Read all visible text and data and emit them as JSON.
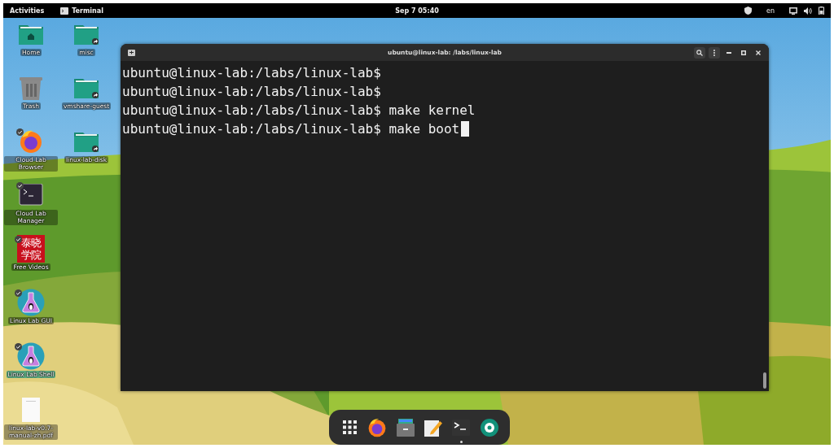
{
  "top_bar": {
    "activities": "Activities",
    "app_name": "Terminal",
    "clock": "Sep 7  05:40",
    "input_source": "en"
  },
  "desktop_columns": [
    [
      {
        "label": "Home",
        "kind": "home-folder",
        "trusted": false,
        "selected": false
      },
      {
        "label": "Trash",
        "kind": "trash",
        "trusted": false,
        "selected": false
      },
      {
        "label": "Cloud Lab Browser",
        "kind": "browser",
        "trusted": true,
        "selected": false
      },
      {
        "label": "Cloud Lab Manager",
        "kind": "terminal-app",
        "trusted": true,
        "selected": false
      },
      {
        "label": "Free Videos",
        "kind": "logo",
        "logo_text": [
          "泰晓",
          "学院"
        ],
        "trusted": true,
        "selected": false
      },
      {
        "label": "Linux Lab GUI",
        "kind": "flask",
        "trusted": true,
        "selected": false
      },
      {
        "label": "Linux Lab Shell",
        "kind": "flask",
        "trusted": true,
        "selected": true
      },
      {
        "label": "linux-lab-v0.7-manual-zh.pdf",
        "kind": "document",
        "trusted": false,
        "selected": false
      }
    ],
    [
      {
        "label": "misc",
        "kind": "link-folder",
        "trusted": false,
        "selected": false
      },
      {
        "label": "vmshare-guest",
        "kind": "link-folder",
        "trusted": false,
        "selected": false
      },
      {
        "label": "linux-lab-disk",
        "kind": "link-folder",
        "trusted": false,
        "selected": false
      }
    ]
  ],
  "terminal": {
    "title": "ubuntu@linux-lab: /labs/linux-lab",
    "lines": [
      {
        "prompt": "ubuntu@linux-lab:/labs/linux-lab$",
        "cursor": false
      },
      {
        "prompt": "ubuntu@linux-lab:/labs/linux-lab$",
        "cursor": false
      },
      {
        "prompt": "ubuntu@linux-lab:/labs/linux-lab$",
        "command": "make kernel",
        "cursor": false
      },
      {
        "prompt": "ubuntu@linux-lab:/labs/linux-lab$",
        "command": "make boot",
        "cursor": true
      }
    ]
  },
  "dock": [
    {
      "kind": "app-grid",
      "running": false
    },
    {
      "kind": "browser",
      "running": false
    },
    {
      "kind": "files",
      "running": false
    },
    {
      "kind": "editor",
      "running": false
    },
    {
      "kind": "terminal",
      "running": true
    },
    {
      "kind": "camera",
      "running": false
    }
  ]
}
